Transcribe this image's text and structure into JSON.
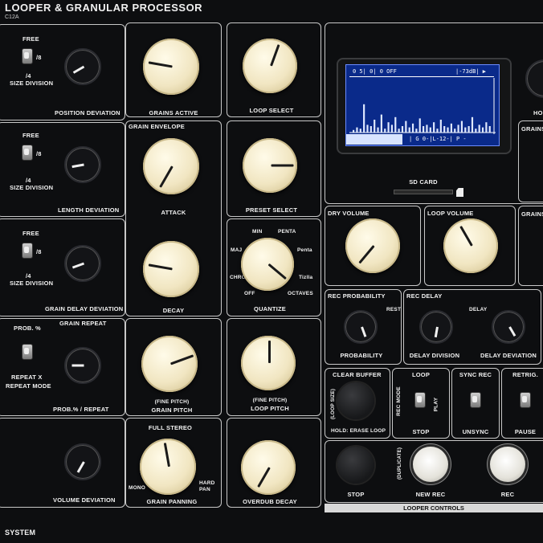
{
  "header": {
    "title": "LOOPER & GRANULAR PROCESSOR",
    "model": "C12A"
  },
  "col1": {
    "position": {
      "free": "FREE",
      "div8": "/8",
      "div4": "/4",
      "size_division": "SIZE DIVISION",
      "knob_label": "POSITION DEVIATION"
    },
    "length": {
      "free": "FREE",
      "div8": "/8",
      "div4": "/4",
      "size_division": "SIZE DIVISION",
      "knob_label": "LENGTH DEVIATION"
    },
    "delay": {
      "free": "FREE",
      "div8": "/8",
      "div4": "/4",
      "size_division": "SIZE DIVISION",
      "knob_label": "GRAIN DELAY DEVIATION"
    },
    "repeat": {
      "prob": "PROB. %",
      "title": "GRAIN REPEAT",
      "repeat_x": "REPEAT X",
      "repeat_mode": "REPEAT MODE",
      "knob_label": "PROB.% / REPEAT"
    },
    "volume": {
      "knob_label": "VOLUME DEVIATION"
    },
    "system": "SYSTEM"
  },
  "col2": {
    "grains_active": "GRAINS ACTIVE",
    "grain_envelope": "GRAIN ENVELOPE",
    "attack": "ATTACK",
    "decay": "DECAY",
    "fine_pitch": "(FINE PITCH)",
    "grain_pitch": "GRAIN PITCH",
    "full_stereo": "FULL STEREO",
    "mono": "MONO",
    "hard_pan": "HARD\nPAN",
    "grain_panning": "GRAIN PANNING"
  },
  "col3": {
    "loop_select": "LOOP SELECT",
    "preset_select": "PRESET SELECT",
    "quantize": {
      "label": "QUANTIZE",
      "min": "MIN",
      "penta": "PENTA",
      "maj": "MAJ",
      "penta2": "Penta",
      "chro": "CHRO",
      "tizlla": "Tizlla",
      "off": "OFF",
      "octaves": "OCTAVES"
    },
    "fine_pitch": "(FINE PITCH)",
    "loop_pitch": "LOOP PITCH",
    "overdub_decay": "OVERDUB DECAY"
  },
  "display": {
    "top_left": "0 5| 0| 0 OFF",
    "top_right": "|-73dB| ▶",
    "bottom": "| G  0-|L-12-| P  -",
    "sd_card": "SD CARD",
    "levels": [
      2,
      4,
      3,
      22,
      6,
      5,
      10,
      4,
      14,
      3,
      8,
      6,
      12,
      3,
      5,
      9,
      4,
      7,
      3,
      11,
      5,
      6,
      4,
      8,
      3,
      10,
      5,
      4,
      7,
      3,
      6,
      9,
      4,
      5,
      12,
      3,
      6,
      4,
      8,
      5
    ]
  },
  "right": {
    "dry_volume": "DRY VOLUME",
    "loop_volume": "LOOP VOLUME",
    "grains_a": "GRAINS",
    "grains_b": "GRAINS",
    "hol": "HOL",
    "rec_probability": {
      "title": "REC PROBABILITY",
      "rest": "REST",
      "knob": "PROBABILITY"
    },
    "rec_delay": {
      "title": "REC DELAY",
      "delay": "DELAY",
      "division": "DELAY DIVISION",
      "deviation": "DELAY DEVIATION"
    },
    "clear_buffer": {
      "title": "CLEAR BUFFER",
      "loop_size": "(LOOP SIZE)",
      "hold": "HOLD: ERASE LOOP"
    },
    "loop": {
      "title": "LOOP",
      "rec_mode": "REC MODE",
      "play": "PLAY",
      "stop": "STOP"
    },
    "sync_rec": {
      "title": "SYNC REC",
      "unsync": "UNSYNC"
    },
    "retrig": {
      "title": "RETRIG.",
      "pause": "PAUSE"
    },
    "buttons": {
      "stop": "STOP",
      "duplicated": "(DUPLICATE)",
      "new_rec": "NEW REC",
      "rec": "REC"
    },
    "looper_controls": "LOOPER CONTROLS"
  }
}
